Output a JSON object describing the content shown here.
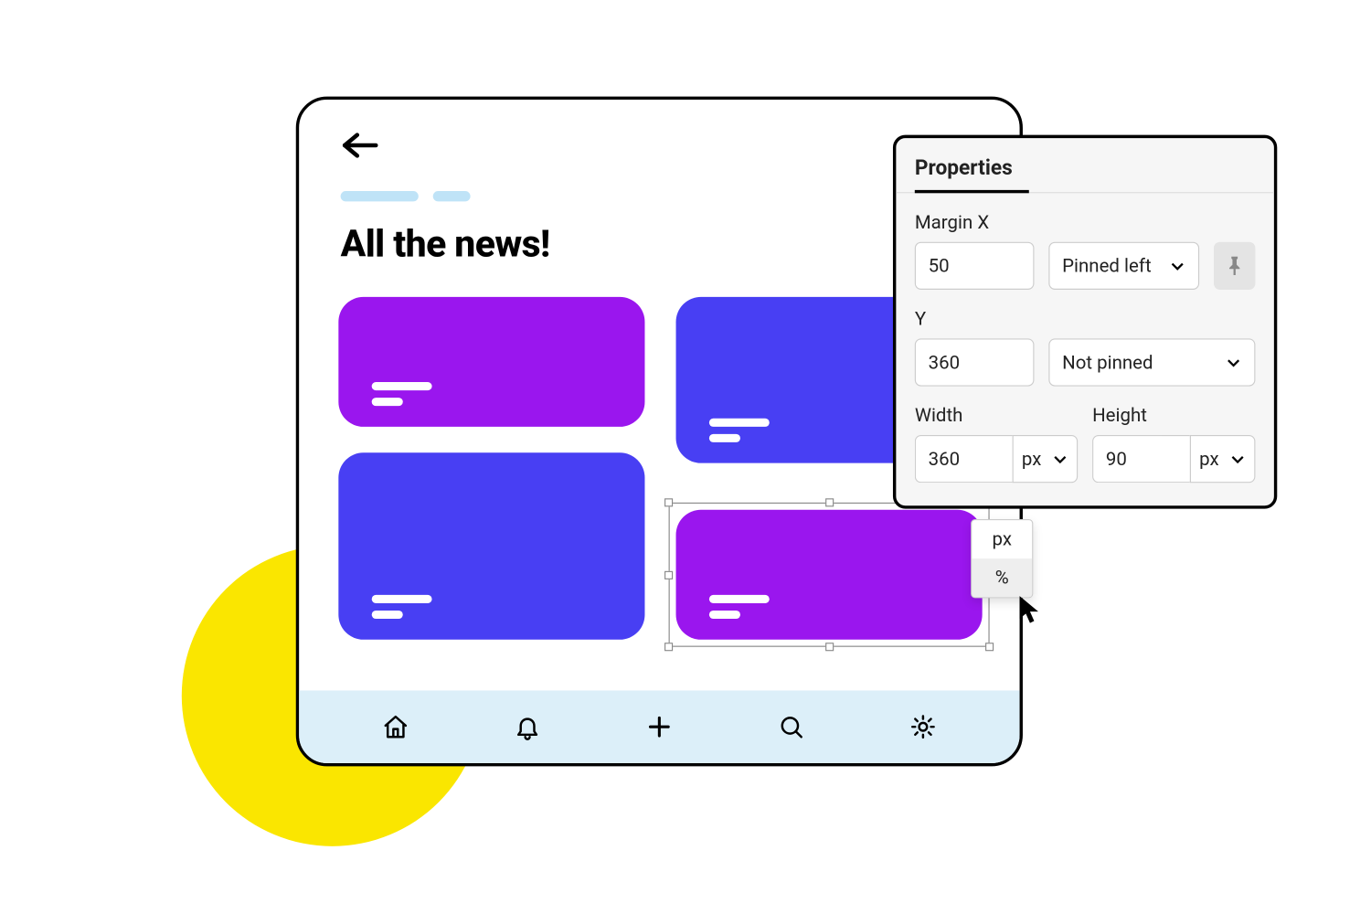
{
  "canvas": {
    "page_title": "All the news!",
    "cards": [
      {
        "id": "card-1",
        "color": "#9A16EE"
      },
      {
        "id": "card-2",
        "color": "#483FF3"
      },
      {
        "id": "card-3",
        "color": "#483FF3"
      },
      {
        "id": "card-4",
        "color": "#9A16EE",
        "selected": true
      }
    ],
    "tabbar_icons": [
      "home",
      "bell",
      "plus",
      "search",
      "gear"
    ]
  },
  "properties": {
    "title": "Properties",
    "margin_x": {
      "label": "Margin X",
      "value": "50",
      "pin": "Pinned left"
    },
    "y": {
      "label": "Y",
      "value": "360",
      "pin": "Not pinned"
    },
    "width": {
      "label": "Width",
      "value": "360",
      "unit": "px",
      "unit_options": [
        "px",
        "%"
      ]
    },
    "height": {
      "label": "Height",
      "value": "90",
      "unit": "px"
    }
  },
  "open_dropdown": {
    "for": "width-unit",
    "options": [
      "px",
      "%"
    ],
    "hovered_index": 1
  }
}
